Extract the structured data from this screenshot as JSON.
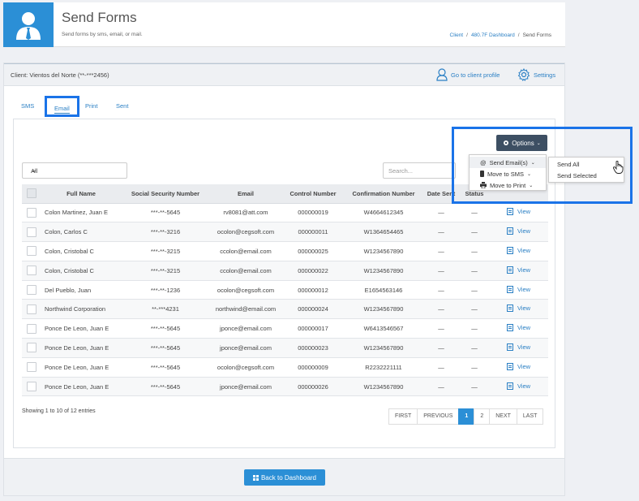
{
  "header": {
    "title": "Send Forms",
    "subtitle": "Send forms by sms, email, or mail.",
    "breadcrumb": [
      {
        "label": "Client",
        "link": true
      },
      {
        "label": "480.7F Dashboard",
        "link": true
      },
      {
        "label": "Send Forms",
        "link": false
      }
    ],
    "breadcrumb_sep": "/"
  },
  "client_bar": {
    "client": "Client: Vientos del Norte (**-***2456)",
    "profile_link": "Go to client profile",
    "settings_link": "Settings"
  },
  "tabs": [
    {
      "label": "SMS",
      "active": false
    },
    {
      "label": "Email",
      "active": true
    },
    {
      "label": "Print",
      "active": false
    },
    {
      "label": "Sent",
      "active": false
    }
  ],
  "filter": {
    "selected": "All",
    "search_placeholder": "Search..."
  },
  "options": {
    "button": "Options",
    "menu": [
      "Send Email(s)",
      "Move to SMS",
      "Move to Print"
    ],
    "submenu": [
      "Send All",
      "Send Selected"
    ]
  },
  "table": {
    "columns": [
      "",
      "Full Name",
      "Social Security Number",
      "Email",
      "Control Number",
      "Confirmation Number",
      "Date Sent",
      "Status",
      ""
    ],
    "view_label": "View",
    "rows": [
      {
        "name": "Colon Martinez, Juan E",
        "ssn": "***-**-5645",
        "email": "rv8081@att.com",
        "control": "000000019",
        "confirmation": "W4664612345",
        "date": "—",
        "status": "—"
      },
      {
        "name": "Colon, Carlos C",
        "ssn": "***-**-3216",
        "email": "ocolon@cegsoft.com",
        "control": "000000011",
        "confirmation": "W1364654465",
        "date": "—",
        "status": "—"
      },
      {
        "name": "Colon, Cristobal C",
        "ssn": "***-**-3215",
        "email": "ccolon@email.com",
        "control": "000000025",
        "confirmation": "W1234567890",
        "date": "—",
        "status": "—"
      },
      {
        "name": "Colon, Cristobal C",
        "ssn": "***-**-3215",
        "email": "ccolon@email.com",
        "control": "000000022",
        "confirmation": "W1234567890",
        "date": "—",
        "status": "—"
      },
      {
        "name": "Del Pueblo, Juan",
        "ssn": "***-**-1236",
        "email": "ocolon@cegsoft.com",
        "control": "000000012",
        "confirmation": "E1654563146",
        "date": "—",
        "status": "—"
      },
      {
        "name": "Northwind Corporation",
        "ssn": "**-***4231",
        "email": "northwind@email.com",
        "control": "000000024",
        "confirmation": "W1234567890",
        "date": "—",
        "status": "—"
      },
      {
        "name": "Ponce De Leon, Juan E",
        "ssn": "***-**-5645",
        "email": "jponce@email.com",
        "control": "000000017",
        "confirmation": "W6413546567",
        "date": "—",
        "status": "—"
      },
      {
        "name": "Ponce De Leon, Juan E",
        "ssn": "***-**-5645",
        "email": "jponce@email.com",
        "control": "000000023",
        "confirmation": "W1234567890",
        "date": "—",
        "status": "—"
      },
      {
        "name": "Ponce De Leon, Juan E",
        "ssn": "***-**-5645",
        "email": "ocolon@cegsoft.com",
        "control": "000000009",
        "confirmation": "R2232221111",
        "date": "—",
        "status": "—"
      },
      {
        "name": "Ponce De Leon, Juan E",
        "ssn": "***-**-5645",
        "email": "jponce@email.com",
        "control": "000000026",
        "confirmation": "W1234567890",
        "date": "—",
        "status": "—"
      }
    ]
  },
  "pagination": {
    "showing": "Showing 1 to 10 of 12 entries",
    "buttons": [
      {
        "label": "FIRST",
        "active": false
      },
      {
        "label": "PREVIOUS",
        "active": false
      },
      {
        "label": "1",
        "active": true
      },
      {
        "label": "2",
        "active": false
      },
      {
        "label": "NEXT",
        "active": false
      },
      {
        "label": "LAST",
        "active": false
      }
    ]
  },
  "footer": {
    "back_button": "Back to Dashboard"
  },
  "colors": {
    "primary": "#2b8fd6",
    "link": "#2a7fc4",
    "highlight": "#1a73e8",
    "options_btn": "#3d4f63"
  }
}
